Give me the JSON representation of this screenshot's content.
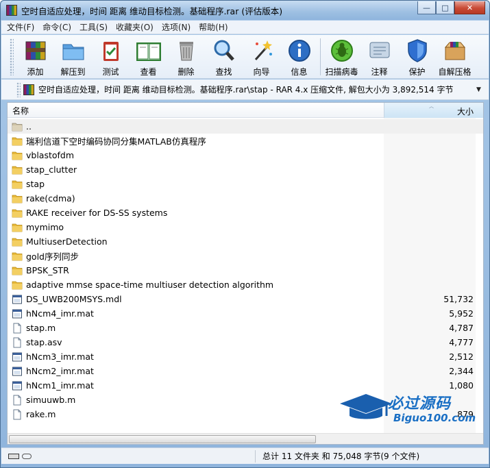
{
  "window": {
    "title": "空时自适应处理，时间 距离 维动目标检测。基础程序.rar (评估版本)",
    "controls": {
      "minimize": "—",
      "maximize": "□",
      "close": "✕"
    }
  },
  "menu": [
    "文件(F)",
    "命令(C)",
    "工具(S)",
    "收藏夹(O)",
    "选项(N)",
    "帮助(H)"
  ],
  "toolbar": [
    {
      "label": "添加",
      "icon": "add-archive-icon"
    },
    {
      "label": "解压到",
      "icon": "extract-folder-icon"
    },
    {
      "label": "测试",
      "icon": "test-clipboard-icon"
    },
    {
      "label": "查看",
      "icon": "view-book-icon"
    },
    {
      "label": "删除",
      "icon": "trash-icon"
    },
    {
      "label": "查找",
      "icon": "magnifier-icon"
    },
    {
      "label": "向导",
      "icon": "wizard-wand-icon"
    },
    {
      "label": "信息",
      "icon": "info-icon"
    },
    {
      "label": "扫描病毒",
      "icon": "virus-scan-icon"
    },
    {
      "label": "注释",
      "icon": "comment-icon"
    },
    {
      "label": "保护",
      "icon": "shield-icon"
    },
    {
      "label": "自解压格",
      "icon": "sfx-box-icon"
    }
  ],
  "address": {
    "path": "空时自适应处理，时间 距离 维动目标检测。基础程序.rar\\stap - RAR 4.x 压缩文件, 解包大小为 3,892,514 字节",
    "dropdown": "▼"
  },
  "list": {
    "columns": {
      "name": "名称",
      "size": "大小",
      "sort_arrow": "︿"
    },
    "rows": [
      {
        "name": "..",
        "size": "",
        "type": "up"
      },
      {
        "name": "瑞利信道下空时编码协同分集MATLAB仿真程序",
        "size": "",
        "type": "folder"
      },
      {
        "name": "vblastofdm",
        "size": "",
        "type": "folder"
      },
      {
        "name": "stap_clutter",
        "size": "",
        "type": "folder"
      },
      {
        "name": "stap",
        "size": "",
        "type": "folder"
      },
      {
        "name": "rake(cdma)",
        "size": "",
        "type": "folder"
      },
      {
        "name": "RAKE receiver for DS-SS systems",
        "size": "",
        "type": "folder"
      },
      {
        "name": "mymimo",
        "size": "",
        "type": "folder"
      },
      {
        "name": "MultiuserDetection",
        "size": "",
        "type": "folder"
      },
      {
        "name": "gold序列同步",
        "size": "",
        "type": "folder"
      },
      {
        "name": "BPSK_STR",
        "size": "",
        "type": "folder"
      },
      {
        "name": "adaptive mmse space-time multiuser detection algorithm",
        "size": "",
        "type": "folder"
      },
      {
        "name": "DS_UWB200MSYS.mdl",
        "size": "51,732",
        "type": "app"
      },
      {
        "name": "hNcm4_imr.mat",
        "size": "5,952",
        "type": "app"
      },
      {
        "name": "stap.m",
        "size": "4,787",
        "type": "doc"
      },
      {
        "name": "stap.asv",
        "size": "4,777",
        "type": "doc"
      },
      {
        "name": "hNcm3_imr.mat",
        "size": "2,512",
        "type": "app"
      },
      {
        "name": "hNcm2_imr.mat",
        "size": "2,344",
        "type": "app"
      },
      {
        "name": "hNcm1_imr.mat",
        "size": "1,080",
        "type": "app"
      },
      {
        "name": "simuuwb.m",
        "size": "",
        "type": "doc"
      },
      {
        "name": "rake.m",
        "size": "879",
        "type": "doc"
      }
    ]
  },
  "status": {
    "summary": "总计 11 文件夹 和 75,048 字节(9 个文件)"
  },
  "watermark": {
    "cn": "必过源码",
    "en": "Biguo100.com"
  },
  "colors": {
    "folder": "#e8b93a",
    "accent": "#1a6fc4",
    "titlebar": "#9dbfe2"
  }
}
